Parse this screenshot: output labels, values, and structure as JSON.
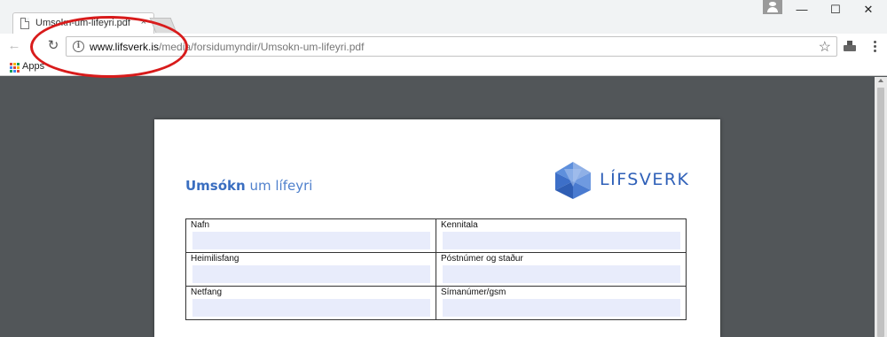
{
  "browser": {
    "tab_title": "Umsokn-um-lifeyri.pdf",
    "tab_close": "×",
    "window_controls": {
      "minimize": "—",
      "maximize": "☐",
      "close": "✕"
    },
    "url_host": "www.lifsverk.is",
    "url_path": "/media/forsidumyndir/Umsokn-um-lifeyri.pdf",
    "bookmarks": {
      "apps_label": "Apps"
    },
    "icons": [
      "back-icon",
      "reload-icon",
      "info-icon",
      "star-icon",
      "extension-icon",
      "menu-icon",
      "apps-icon",
      "profile-icon"
    ]
  },
  "document": {
    "title_bold": "Umsókn",
    "title_light": "um lífeyri",
    "logo_text": "LÍFSVERK",
    "fields": [
      {
        "label": "Nafn",
        "value": ""
      },
      {
        "label": "Kennitala",
        "value": ""
      },
      {
        "label": "Heimilisfang",
        "value": ""
      },
      {
        "label": "Póstnúmer og staður",
        "value": ""
      },
      {
        "label": "Netfang",
        "value": ""
      },
      {
        "label": "Símanúmer/gsm",
        "value": ""
      }
    ]
  },
  "colors": {
    "annotation_ellipse": "#d81b1b",
    "brand_blue": "#2f60b8",
    "field_fill": "#e8ecfb",
    "viewer_bg": "#525659"
  }
}
